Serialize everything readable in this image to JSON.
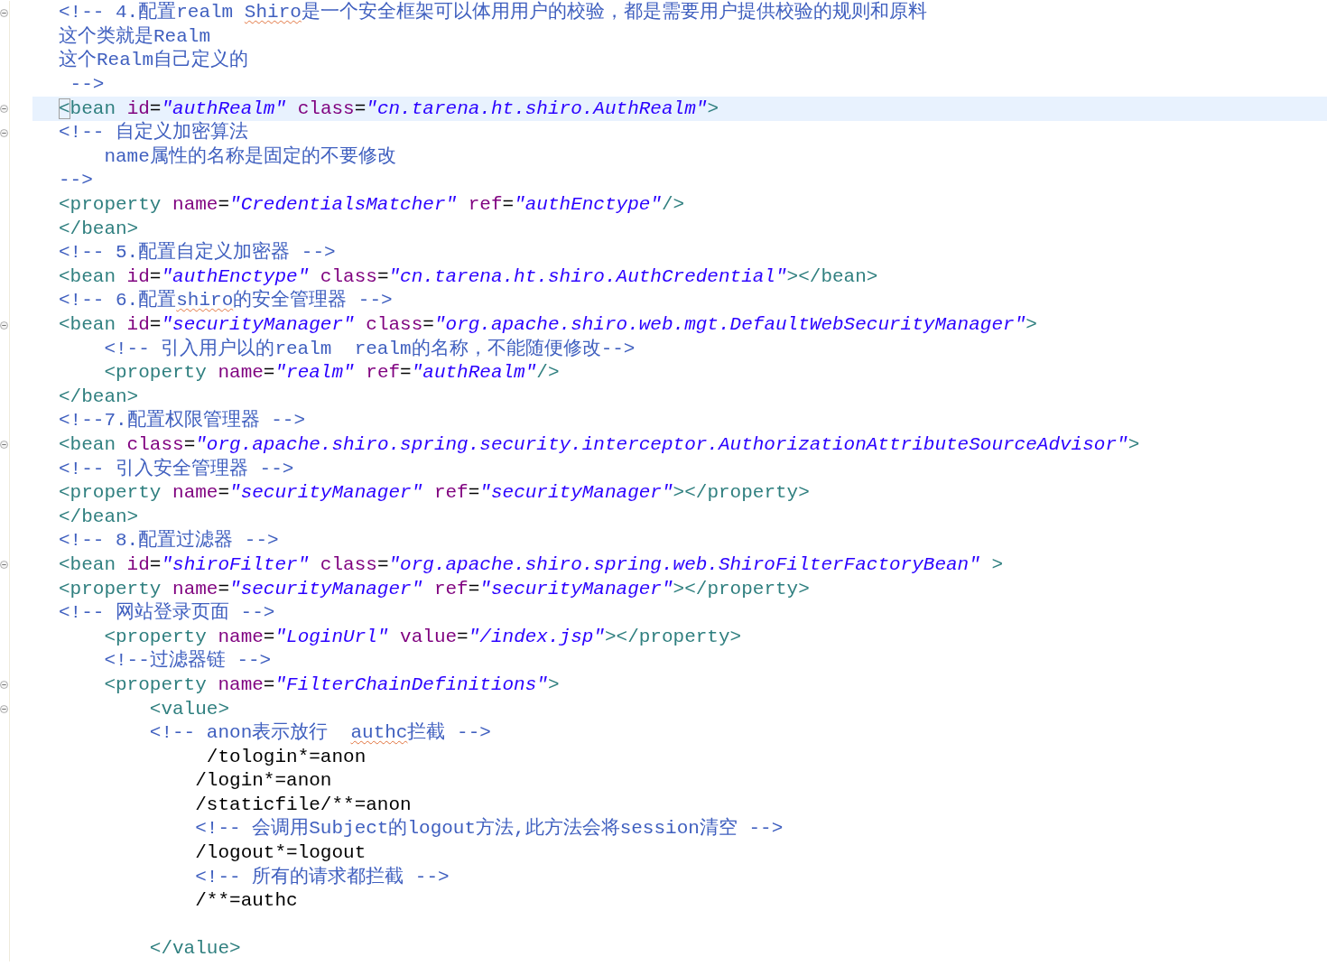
{
  "editor": {
    "lines": [
      {
        "collapsible": true,
        "current": false,
        "tokens": [
          {
            "kind": "comment",
            "text": "<!-- 4.配置realm "
          },
          {
            "kind": "misspelled",
            "text": "Shiro"
          },
          {
            "kind": "comment",
            "text": "是一个安全框架可以体用用户的校验，都是需要用户提供校验的规则和原料"
          }
        ]
      },
      {
        "collapsible": false,
        "current": false,
        "tokens": [
          {
            "kind": "comment",
            "text": "这个类就是Realm"
          }
        ]
      },
      {
        "collapsible": false,
        "current": false,
        "tokens": [
          {
            "kind": "comment",
            "text": "这个Realm自己定义的"
          }
        ]
      },
      {
        "collapsible": false,
        "current": false,
        "tokens": [
          {
            "kind": "comment",
            "text": " -->"
          }
        ]
      },
      {
        "collapsible": true,
        "current": true,
        "tokens": [
          {
            "kind": "bracket-match",
            "text": "<"
          },
          {
            "kind": "tag",
            "text": "bean"
          },
          {
            "kind": "attr",
            "text": " id"
          },
          {
            "kind": "eq",
            "text": "="
          },
          {
            "kind": "value",
            "text": "\"authRealm\""
          },
          {
            "kind": "attr",
            "text": " class"
          },
          {
            "kind": "eq",
            "text": "="
          },
          {
            "kind": "value",
            "text": "\"cn.tarena.ht.shiro.AuthRealm\""
          },
          {
            "kind": "tag",
            "text": ">"
          }
        ]
      },
      {
        "collapsible": true,
        "current": false,
        "tokens": [
          {
            "kind": "comment",
            "text": "<!-- 自定义加密算法"
          }
        ]
      },
      {
        "collapsible": false,
        "current": false,
        "tokens": [
          {
            "kind": "comment",
            "text": "    name属性的名称是固定的不要修改"
          }
        ]
      },
      {
        "collapsible": false,
        "current": false,
        "tokens": [
          {
            "kind": "comment",
            "text": "-->"
          }
        ]
      },
      {
        "collapsible": false,
        "current": false,
        "tokens": [
          {
            "kind": "tag",
            "text": "<property"
          },
          {
            "kind": "attr",
            "text": " name"
          },
          {
            "kind": "eq",
            "text": "="
          },
          {
            "kind": "value",
            "text": "\"CredentialsMatcher\""
          },
          {
            "kind": "attr",
            "text": " ref"
          },
          {
            "kind": "eq",
            "text": "="
          },
          {
            "kind": "value",
            "text": "\"authEnctype\""
          },
          {
            "kind": "tag",
            "text": "/>"
          }
        ]
      },
      {
        "collapsible": false,
        "current": false,
        "tokens": [
          {
            "kind": "tag",
            "text": "</bean>"
          }
        ]
      },
      {
        "collapsible": false,
        "current": false,
        "tokens": [
          {
            "kind": "comment",
            "text": "<!-- 5.配置自定义加密器 -->"
          }
        ]
      },
      {
        "collapsible": false,
        "current": false,
        "tokens": [
          {
            "kind": "tag",
            "text": "<bean"
          },
          {
            "kind": "attr",
            "text": " id"
          },
          {
            "kind": "eq",
            "text": "="
          },
          {
            "kind": "value",
            "text": "\"authEnctype\""
          },
          {
            "kind": "attr",
            "text": " class"
          },
          {
            "kind": "eq",
            "text": "="
          },
          {
            "kind": "value",
            "text": "\"cn.tarena.ht.shiro.AuthCredential\""
          },
          {
            "kind": "tag",
            "text": "></bean>"
          }
        ]
      },
      {
        "collapsible": false,
        "current": false,
        "tokens": [
          {
            "kind": "comment",
            "text": "<!-- 6.配置"
          },
          {
            "kind": "misspelled",
            "text": "shiro"
          },
          {
            "kind": "comment",
            "text": "的安全管理器 -->"
          }
        ]
      },
      {
        "collapsible": true,
        "current": false,
        "tokens": [
          {
            "kind": "tag",
            "text": "<bean"
          },
          {
            "kind": "attr",
            "text": " id"
          },
          {
            "kind": "eq",
            "text": "="
          },
          {
            "kind": "value",
            "text": "\"securityManager\""
          },
          {
            "kind": "attr",
            "text": " class"
          },
          {
            "kind": "eq",
            "text": "="
          },
          {
            "kind": "value",
            "text": "\"org.apache.shiro.web.mgt.DefaultWebSecurityManager\""
          },
          {
            "kind": "tag",
            "text": ">"
          }
        ]
      },
      {
        "collapsible": false,
        "current": false,
        "tokens": [
          {
            "kind": "comment",
            "text": "    <!-- 引入用户以的realm  realm的名称，不能随便修改-->"
          }
        ]
      },
      {
        "collapsible": false,
        "current": false,
        "tokens": [
          {
            "kind": "tag",
            "text": "    <property"
          },
          {
            "kind": "attr",
            "text": " name"
          },
          {
            "kind": "eq",
            "text": "="
          },
          {
            "kind": "value",
            "text": "\"realm\""
          },
          {
            "kind": "attr",
            "text": " ref"
          },
          {
            "kind": "eq",
            "text": "="
          },
          {
            "kind": "value",
            "text": "\"authRealm\""
          },
          {
            "kind": "tag",
            "text": "/>"
          }
        ]
      },
      {
        "collapsible": false,
        "current": false,
        "tokens": [
          {
            "kind": "tag",
            "text": "</bean>"
          }
        ]
      },
      {
        "collapsible": false,
        "current": false,
        "tokens": [
          {
            "kind": "comment",
            "text": "<!--7.配置权限管理器 -->"
          }
        ]
      },
      {
        "collapsible": true,
        "current": false,
        "tokens": [
          {
            "kind": "tag",
            "text": "<bean"
          },
          {
            "kind": "attr",
            "text": " class"
          },
          {
            "kind": "eq",
            "text": "="
          },
          {
            "kind": "value",
            "text": "\"org.apache.shiro.spring.security.interceptor.AuthorizationAttributeSourceAdvisor\""
          },
          {
            "kind": "tag",
            "text": ">"
          }
        ]
      },
      {
        "collapsible": false,
        "current": false,
        "tokens": [
          {
            "kind": "comment",
            "text": "<!-- 引入安全管理器 -->"
          }
        ]
      },
      {
        "collapsible": false,
        "current": false,
        "tokens": [
          {
            "kind": "tag",
            "text": "<property"
          },
          {
            "kind": "attr",
            "text": " name"
          },
          {
            "kind": "eq",
            "text": "="
          },
          {
            "kind": "value",
            "text": "\"securityManager\""
          },
          {
            "kind": "attr",
            "text": " ref"
          },
          {
            "kind": "eq",
            "text": "="
          },
          {
            "kind": "value",
            "text": "\"securityManager\""
          },
          {
            "kind": "tag",
            "text": "></property>"
          }
        ]
      },
      {
        "collapsible": false,
        "current": false,
        "tokens": [
          {
            "kind": "tag",
            "text": "</bean>"
          }
        ]
      },
      {
        "collapsible": false,
        "current": false,
        "tokens": [
          {
            "kind": "comment",
            "text": "<!-- 8.配置过滤器 -->"
          }
        ]
      },
      {
        "collapsible": true,
        "current": false,
        "tokens": [
          {
            "kind": "tag",
            "text": "<bean"
          },
          {
            "kind": "attr",
            "text": " id"
          },
          {
            "kind": "eq",
            "text": "="
          },
          {
            "kind": "value",
            "text": "\"shiroFilter\""
          },
          {
            "kind": "attr",
            "text": " class"
          },
          {
            "kind": "eq",
            "text": "="
          },
          {
            "kind": "value",
            "text": "\"org.apache.shiro.spring.web.ShiroFilterFactoryBean\""
          },
          {
            "kind": "tag",
            "text": " >"
          }
        ]
      },
      {
        "collapsible": false,
        "current": false,
        "tokens": [
          {
            "kind": "tag",
            "text": "<property"
          },
          {
            "kind": "attr",
            "text": " name"
          },
          {
            "kind": "eq",
            "text": "="
          },
          {
            "kind": "value",
            "text": "\"securityManager\""
          },
          {
            "kind": "attr",
            "text": " ref"
          },
          {
            "kind": "eq",
            "text": "="
          },
          {
            "kind": "value",
            "text": "\"securityManager\""
          },
          {
            "kind": "tag",
            "text": "></property>"
          }
        ]
      },
      {
        "collapsible": false,
        "current": false,
        "tokens": [
          {
            "kind": "comment",
            "text": "<!-- 网站登录页面 -->"
          }
        ]
      },
      {
        "collapsible": false,
        "current": false,
        "tokens": [
          {
            "kind": "tag",
            "text": "    <property"
          },
          {
            "kind": "attr",
            "text": " name"
          },
          {
            "kind": "eq",
            "text": "="
          },
          {
            "kind": "value",
            "text": "\"LoginUrl\""
          },
          {
            "kind": "attr",
            "text": " value"
          },
          {
            "kind": "eq",
            "text": "="
          },
          {
            "kind": "value",
            "text": "\"/index.jsp\""
          },
          {
            "kind": "tag",
            "text": "></property>"
          }
        ]
      },
      {
        "collapsible": false,
        "current": false,
        "tokens": [
          {
            "kind": "comment",
            "text": "    <!--过滤器链 -->"
          }
        ]
      },
      {
        "collapsible": true,
        "current": false,
        "tokens": [
          {
            "kind": "tag",
            "text": "    <property"
          },
          {
            "kind": "attr",
            "text": " name"
          },
          {
            "kind": "eq",
            "text": "="
          },
          {
            "kind": "value",
            "text": "\"FilterChainDefinitions\""
          },
          {
            "kind": "tag",
            "text": ">"
          }
        ]
      },
      {
        "collapsible": true,
        "current": false,
        "tokens": [
          {
            "kind": "tag",
            "text": "        <value>"
          }
        ]
      },
      {
        "collapsible": false,
        "current": false,
        "tokens": [
          {
            "kind": "comment",
            "text": "        <!-- anon表示放行  "
          },
          {
            "kind": "misspelled",
            "text": "authc"
          },
          {
            "kind": "comment",
            "text": "拦截 -->"
          }
        ]
      },
      {
        "collapsible": false,
        "current": false,
        "tokens": [
          {
            "kind": "text",
            "text": "             /tologin*=anon"
          }
        ]
      },
      {
        "collapsible": false,
        "current": false,
        "tokens": [
          {
            "kind": "text",
            "text": "            /login*=anon"
          }
        ]
      },
      {
        "collapsible": false,
        "current": false,
        "tokens": [
          {
            "kind": "text",
            "text": "            /staticfile/**=anon"
          }
        ]
      },
      {
        "collapsible": false,
        "current": false,
        "tokens": [
          {
            "kind": "comment",
            "text": "            <!-- 会调用Subject的logout方法,此方法会将session清空 -->"
          }
        ]
      },
      {
        "collapsible": false,
        "current": false,
        "tokens": [
          {
            "kind": "text",
            "text": "            /logout*=logout"
          }
        ]
      },
      {
        "collapsible": false,
        "current": false,
        "tokens": [
          {
            "kind": "comment",
            "text": "            <!-- 所有的请求都拦截 -->"
          }
        ]
      },
      {
        "collapsible": false,
        "current": false,
        "tokens": [
          {
            "kind": "text",
            "text": "            /**=authc"
          }
        ]
      },
      {
        "collapsible": false,
        "current": false
      },
      {
        "collapsible": false,
        "current": false,
        "tokens": [
          {
            "kind": "tag",
            "text": "        </value>"
          }
        ]
      }
    ]
  }
}
